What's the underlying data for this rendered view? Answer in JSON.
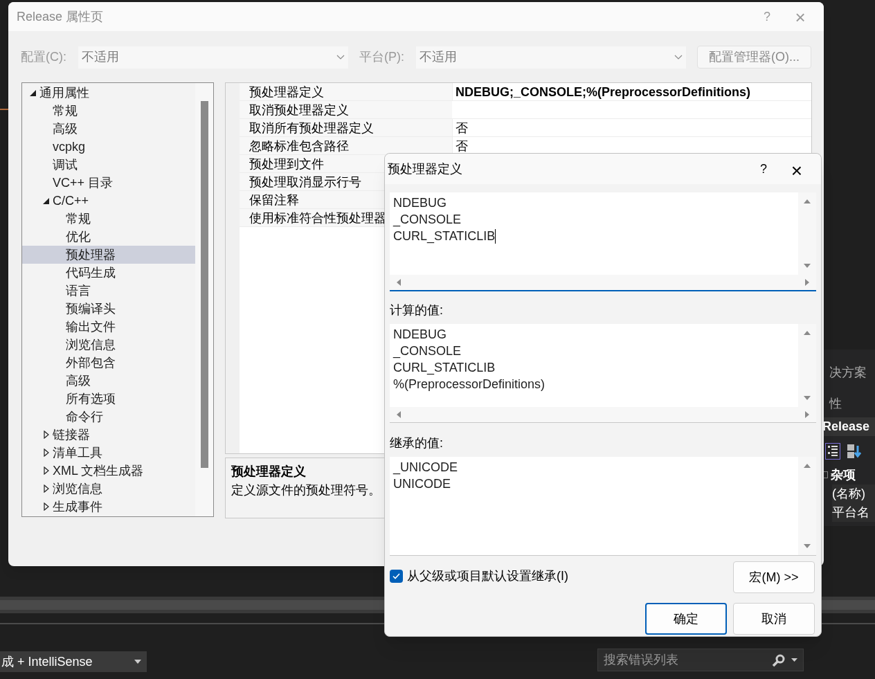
{
  "background": {
    "side_panel": {
      "title": "决方案",
      "section": "性",
      "object": "Release",
      "category": "杂项",
      "properties": [
        "(名称)",
        "平台名"
      ]
    },
    "config_dropdown": {
      "value": "成 + IntelliSense"
    },
    "error_search": {
      "placeholder": "搜索错误列表"
    }
  },
  "dialog": {
    "title": "Release 属性页",
    "help": "?",
    "close": "×",
    "configuration": {
      "label": "配置(C):",
      "value": "不适用",
      "disabled": true
    },
    "platform": {
      "label": "平台(P):",
      "value": "不适用",
      "disabled": true
    },
    "manager_button": "配置管理器(O)...",
    "tree": [
      {
        "label": "通用属性",
        "expanded": true,
        "selected": false,
        "children": [
          {
            "label": "常规",
            "selected": false
          },
          {
            "label": "高级",
            "selected": false
          },
          {
            "label": "vcpkg",
            "selected": false
          },
          {
            "label": "调试",
            "selected": false
          },
          {
            "label": "VC++ 目录",
            "selected": false
          },
          {
            "label": "C/C++",
            "expanded": true,
            "selected": false,
            "children": [
              {
                "label": "常规",
                "selected": false
              },
              {
                "label": "优化",
                "selected": false
              },
              {
                "label": "预处理器",
                "selected": true
              },
              {
                "label": "代码生成",
                "selected": false
              },
              {
                "label": "语言",
                "selected": false
              },
              {
                "label": "预编译头",
                "selected": false
              },
              {
                "label": "输出文件",
                "selected": false
              },
              {
                "label": "浏览信息",
                "selected": false
              },
              {
                "label": "外部包含",
                "selected": false
              },
              {
                "label": "高级",
                "selected": false
              },
              {
                "label": "所有选项",
                "selected": false
              },
              {
                "label": "命令行",
                "selected": false
              }
            ]
          },
          {
            "label": "链接器",
            "expanded": false,
            "selected": false
          },
          {
            "label": "清单工具",
            "expanded": false,
            "selected": false
          },
          {
            "label": "XML 文档生成器",
            "expanded": false,
            "selected": false
          },
          {
            "label": "浏览信息",
            "expanded": false,
            "selected": false
          },
          {
            "label": "生成事件",
            "expanded": false,
            "selected": false
          }
        ]
      }
    ],
    "properties": [
      {
        "name": "预处理器定义",
        "value": "NDEBUG;_CONSOLE;%(PreprocessorDefinitions)",
        "modified": true
      },
      {
        "name": "取消预处理器定义"
      },
      {
        "name": "取消所有预处理器定义",
        "value": "否",
        "modified": false
      },
      {
        "name": "忽略标准包含路径",
        "value": "否",
        "modified": false
      },
      {
        "name": "预处理到文件"
      },
      {
        "name": "预处理取消显示行号"
      },
      {
        "name": "保留注释"
      },
      {
        "name": "使用标准符合性预处理器"
      }
    ],
    "description": {
      "title": "预处理器定义",
      "text": "定义源文件的预处理符号。"
    }
  },
  "editor": {
    "title": "预处理器定义",
    "help": "?",
    "close": "×",
    "lines": [
      "NDEBUG",
      "_CONSOLE",
      "CURL_STATICLIB"
    ],
    "computed_label": "计算的值:",
    "computed": [
      "NDEBUG",
      "_CONSOLE",
      "CURL_STATICLIB",
      "%(PreprocessorDefinitions)"
    ],
    "inherited_label": "继承的值:",
    "inherited": [
      "_UNICODE",
      "UNICODE"
    ],
    "inherit_checkbox": {
      "label": "从父级或项目默认设置继承(I)",
      "checked": true
    },
    "macros_button": "宏(M) >>",
    "ok_button": "确定",
    "cancel_button": "取消"
  }
}
